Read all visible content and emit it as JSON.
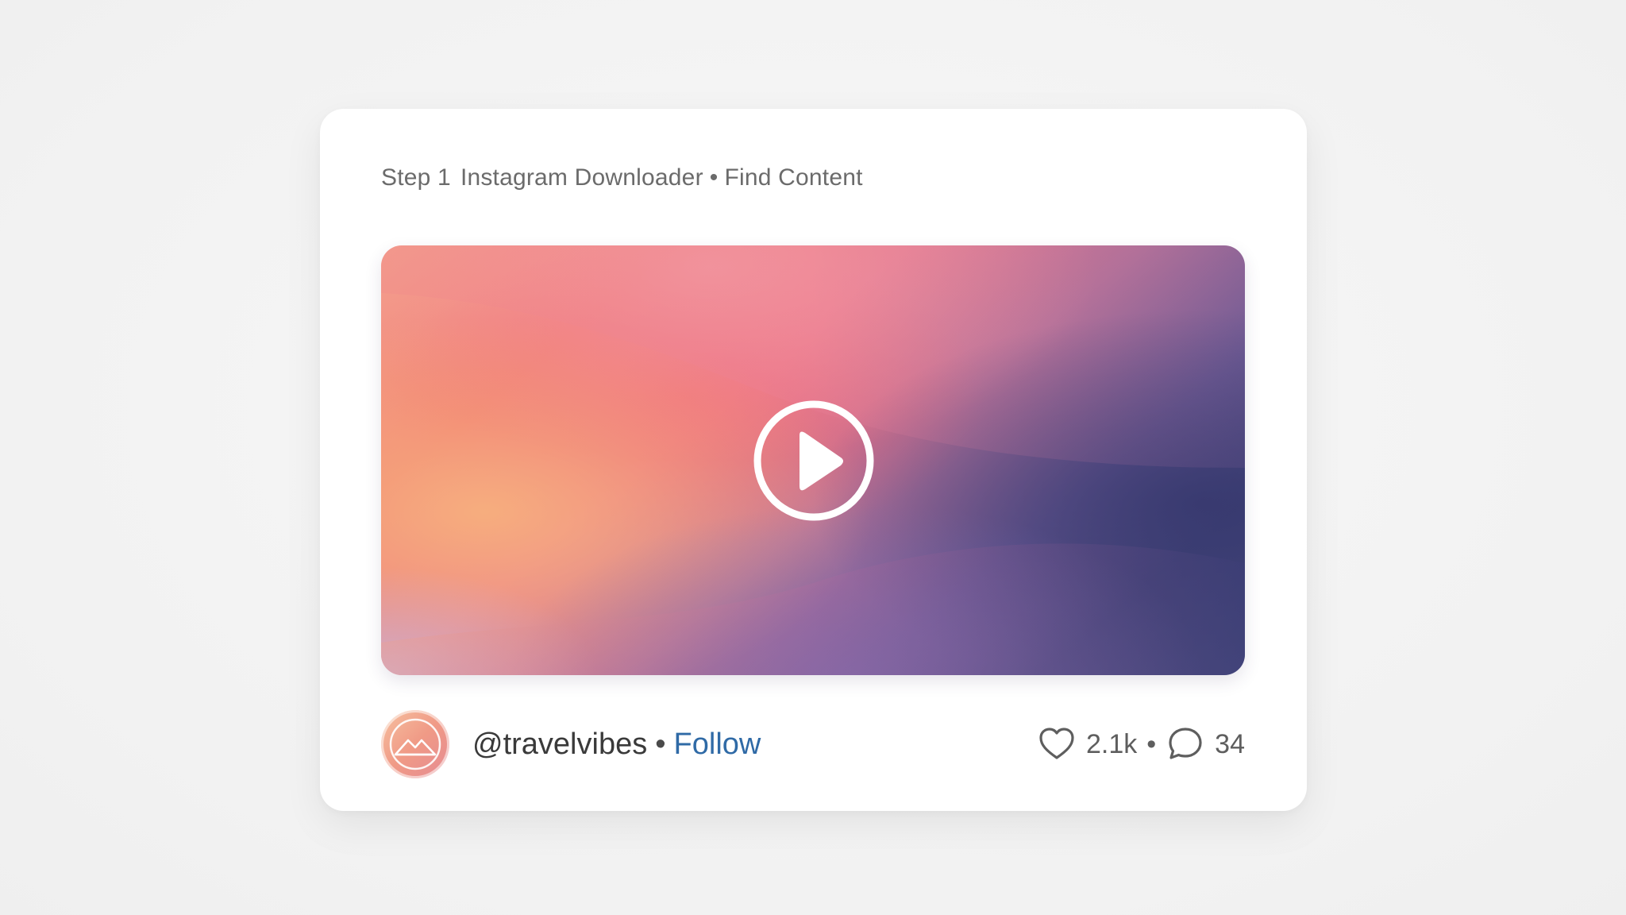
{
  "header": {
    "step": "Step 1",
    "title": "Instagram Downloader",
    "separator": "•",
    "subtitle": "Find Content"
  },
  "media": {
    "play_icon": "play-icon",
    "colors": [
      "#f3a48b",
      "#ee6b68",
      "#e96a86",
      "#9a6aa3",
      "#5a4f8b",
      "#3d3a73"
    ]
  },
  "post": {
    "avatar_icon": "mountain-icon",
    "username": "@travelvibes",
    "separator": "•",
    "follow_label": "Follow",
    "follow_color": "#2f6aa6",
    "likes_icon": "heart-icon",
    "likes": "2.1k",
    "stats_separator": "•",
    "comments_icon": "comment-icon",
    "comments": "34"
  }
}
